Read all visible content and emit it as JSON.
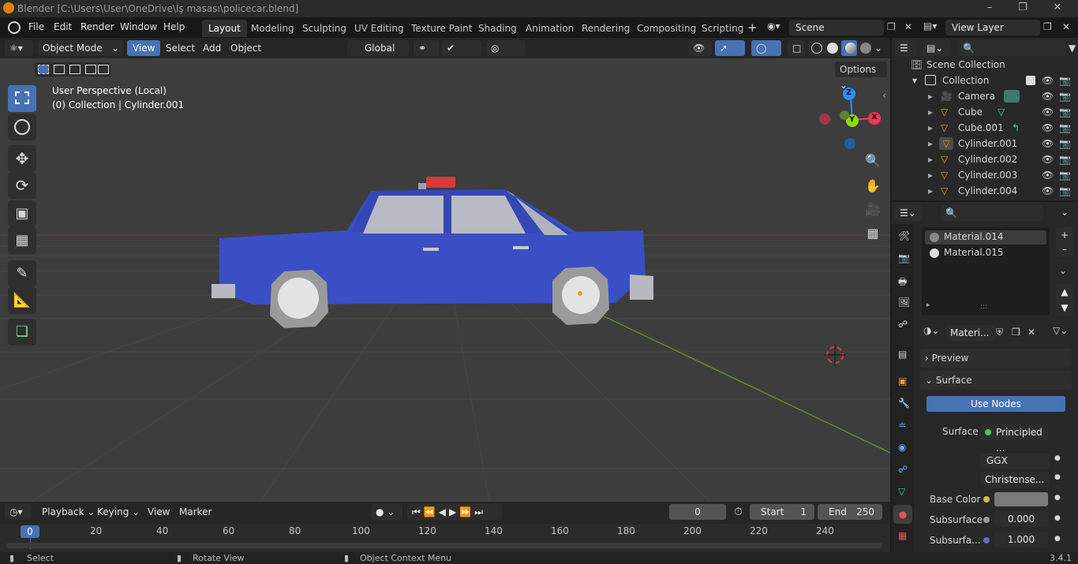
{
  "window": {
    "title": "Blender [C:\\Users\\User\\OneDrive\\İş masası\\policecar.blend]"
  },
  "menu": {
    "items": [
      "File",
      "Edit",
      "Render",
      "Window",
      "Help"
    ]
  },
  "workspaces": {
    "tabs": [
      "Layout",
      "Modeling",
      "Sculpting",
      "UV Editing",
      "Texture Paint",
      "Shading",
      "Animation",
      "Rendering",
      "Compositing",
      "Scripting"
    ],
    "active": "Layout",
    "add": "+"
  },
  "scene": {
    "name": "Scene",
    "view_layer": "View Layer"
  },
  "viewport_header": {
    "mode": "Object Mode",
    "menus": [
      "View",
      "Select",
      "Add",
      "Object"
    ],
    "transform_orientation": "Global",
    "options": "Options"
  },
  "viewport": {
    "perspective": "User Perspective (Local)",
    "collection_info": "(0) Collection | Cylinder.001"
  },
  "gizmo": {
    "z": "Z",
    "y": "Y",
    "x": "X"
  },
  "outliner": {
    "root": "Scene Collection",
    "collection": "Collection",
    "items": [
      "Camera",
      "Cube",
      "Cube.001",
      "Cylinder.001",
      "Cylinder.002",
      "Cylinder.003",
      "Cylinder.004"
    ],
    "selected": "Cylinder.001"
  },
  "properties": {
    "materials": [
      "Material.014",
      "Material.015"
    ],
    "material_name": "Materi...",
    "preview_label": "Preview",
    "surface_label": "Surface",
    "use_nodes": "Use Nodes",
    "surface_field_label": "Surface",
    "surface_value": "Principled ...",
    "distribution": "GGX",
    "subsurface_method": "Christense...",
    "base_color_label": "Base Color",
    "subsurface_label": "Subsurface",
    "subsurface_value": "0.000",
    "subsurface_radius_label": "Subsurfa...",
    "subsurface_radius_value": "1.000",
    "base_color_hex": "#7a7a7a"
  },
  "timeline": {
    "menus": [
      "Playback",
      "Keying",
      "View",
      "Marker"
    ],
    "current_frame": "0",
    "start_label": "Start",
    "start_value": "1",
    "end_label": "End",
    "end_value": "250",
    "ticks": [
      "0",
      "20",
      "40",
      "60",
      "80",
      "100",
      "120",
      "140",
      "160",
      "180",
      "200",
      "220",
      "240"
    ],
    "playhead": "0"
  },
  "status": {
    "select": "Select",
    "rotate": "Rotate View",
    "context": "Object Context Menu",
    "version": "3.4.1"
  },
  "colors": {
    "accent": "#4772b3",
    "car_body": "#3a4fc4",
    "siren": "#d8383b",
    "axis_x": "#ff3352",
    "axis_y": "#8bdc00",
    "axis_z": "#2890ff"
  }
}
